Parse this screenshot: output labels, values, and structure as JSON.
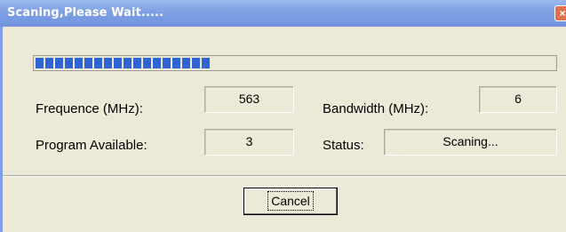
{
  "window": {
    "title": "Scaning,Please Wait.....",
    "close_glyph": "×"
  },
  "progress": {
    "filled_blocks": 18,
    "fraction": 0.4
  },
  "fields": {
    "frequence_label": "Frequence (MHz):",
    "frequence_value": "563",
    "bandwidth_label": "Bandwidth (MHz):",
    "bandwidth_value": "6",
    "program_label": "Program Available:",
    "program_value": "3",
    "status_label": "Status:",
    "status_value": "Scaning..."
  },
  "buttons": {
    "cancel_label": "Cancel"
  },
  "colors": {
    "titlebar": "#7e9fe4",
    "progress_fill": "#2f64d4",
    "dialog_bg": "#ece9d8",
    "close_button": "#e0714f"
  },
  "icons": {
    "close": "close-icon"
  }
}
